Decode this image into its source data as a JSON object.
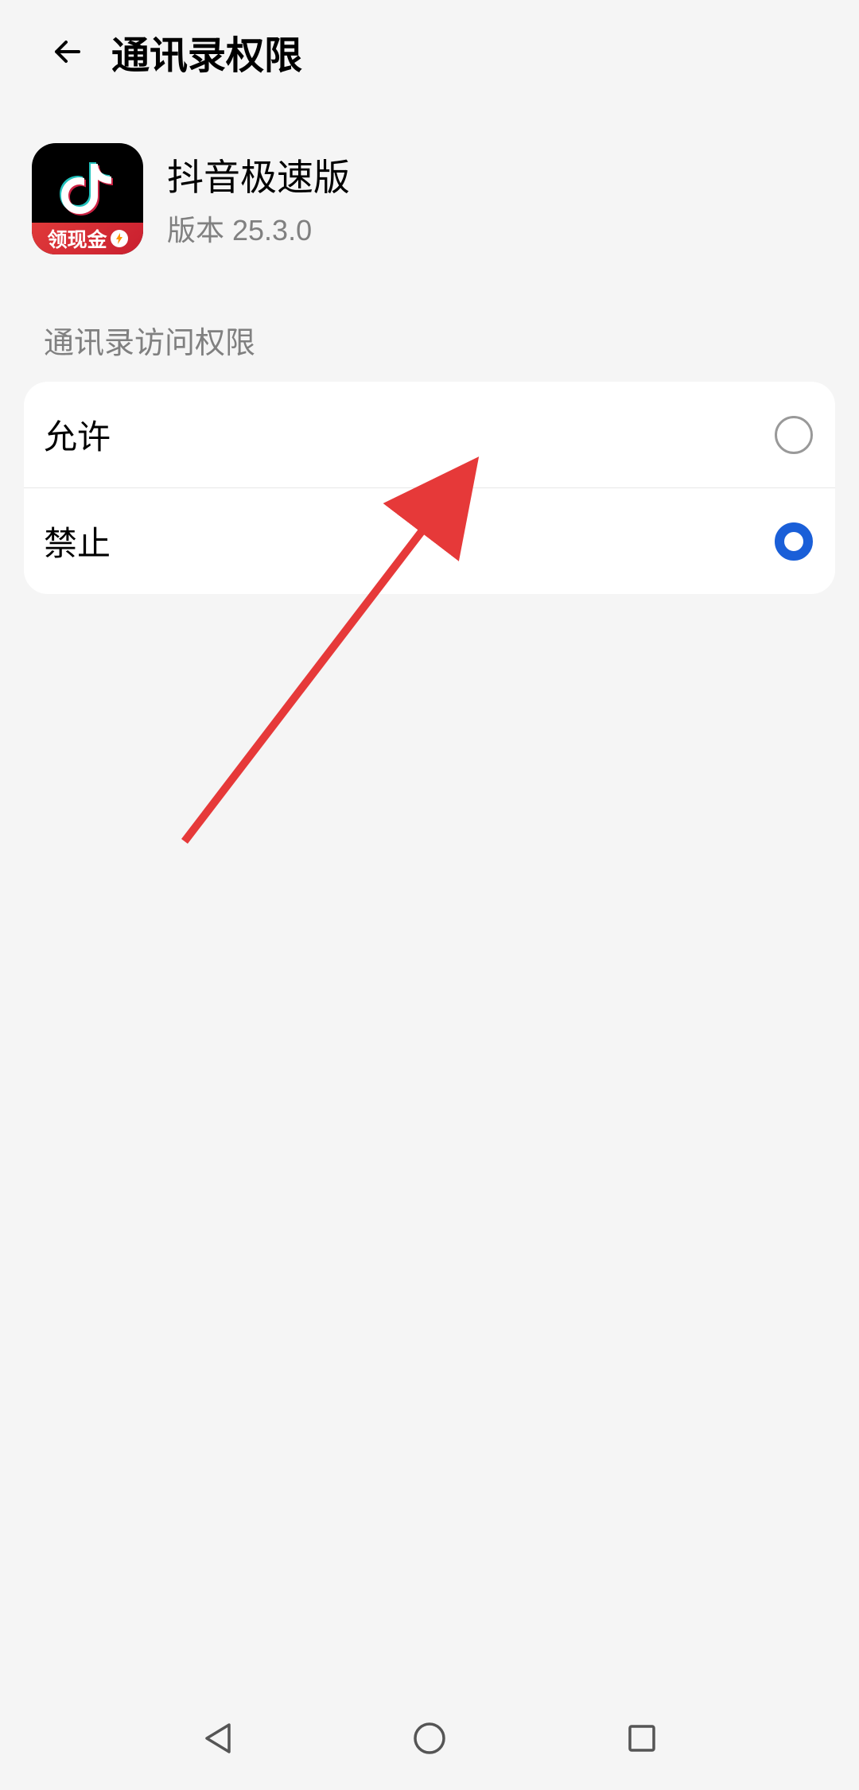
{
  "header": {
    "title": "通讯录权限"
  },
  "app": {
    "name": "抖音极速版",
    "version": "版本 25.3.0",
    "cashBanner": "领现金"
  },
  "section": {
    "title": "通讯录访问权限"
  },
  "options": {
    "allow": "允许",
    "deny": "禁止"
  }
}
